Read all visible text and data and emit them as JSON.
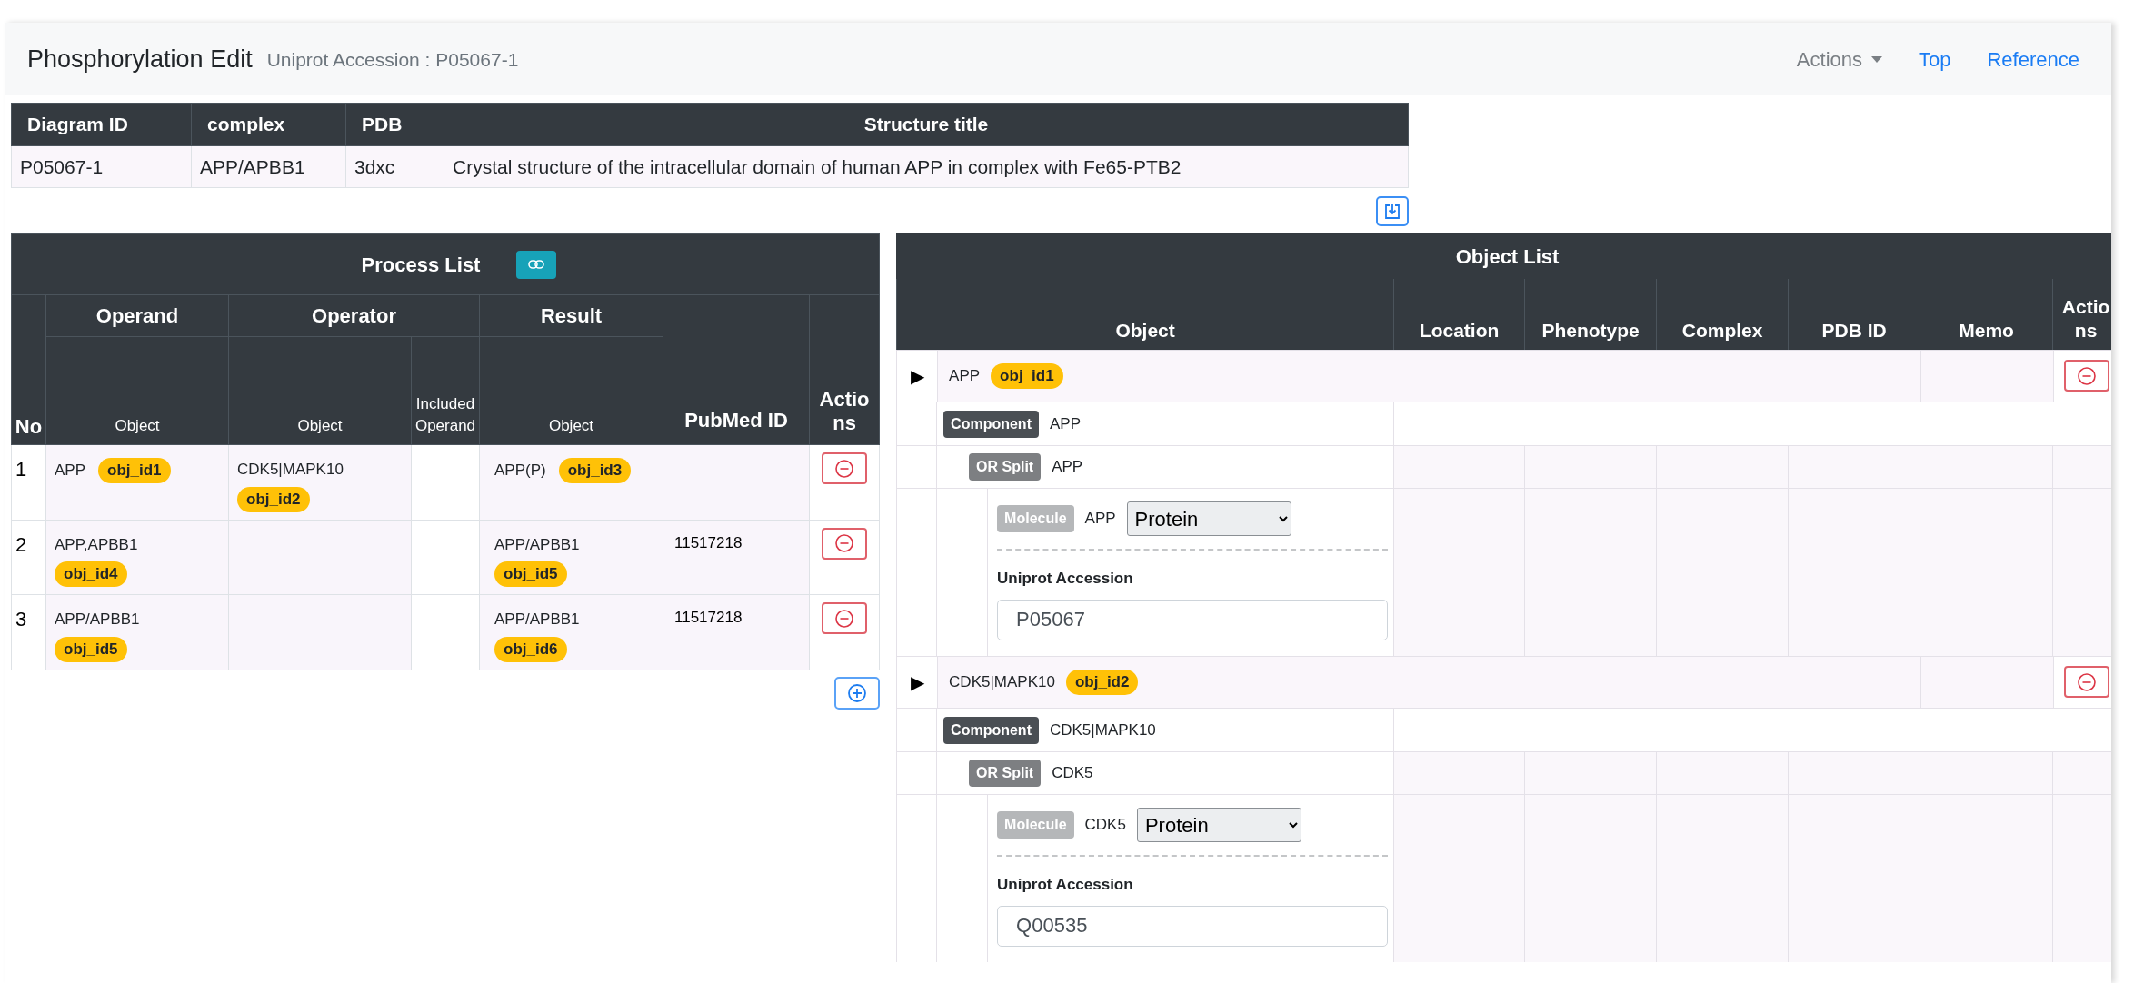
{
  "header": {
    "title": "Phosphorylation Edit",
    "subtitle": "Uniprot Accession : P05067-1",
    "nav": [
      {
        "label": "Actions",
        "kind": "dropdown"
      },
      {
        "label": "Top",
        "kind": "link"
      },
      {
        "label": "Reference",
        "kind": "link"
      }
    ]
  },
  "structure_table": {
    "columns": [
      "Diagram ID",
      "complex",
      "PDB",
      "Structure title"
    ],
    "rows": [
      [
        "P05067-1",
        "APP/APBB1",
        "3dxc",
        "Crystal structure of the intracellular domain of human APP in complex with Fe65-PTB2"
      ]
    ]
  },
  "process_list": {
    "title": "Process List",
    "group_headers": [
      "No",
      "Operand",
      "Operator",
      "Result",
      "PubMed ID",
      "Actions"
    ],
    "sub_headers": [
      "Object",
      "Object",
      "Included Operand",
      "Object"
    ],
    "rows": [
      {
        "no": "1",
        "operand": {
          "name": "APP",
          "id": "obj_id1"
        },
        "operator": {
          "name": "CDK5|MAPK10",
          "id": "obj_id2"
        },
        "result": {
          "name": "APP(P)",
          "id": "obj_id3"
        }
      },
      {
        "no": "2",
        "operand": {
          "name": "APP,APBB1",
          "id": "obj_id4"
        },
        "result": {
          "name": "APP/APBB1",
          "id": "obj_id5"
        },
        "pubmed": "11517218"
      },
      {
        "no": "3",
        "operand": {
          "name": "APP/APBB1",
          "id": "obj_id5"
        },
        "result": {
          "name": "APP/APBB1",
          "id": "obj_id6"
        },
        "pubmed": "11517218"
      }
    ]
  },
  "object_list": {
    "title": "Object List",
    "columns": [
      "Object",
      "Location",
      "Phenotype",
      "Complex",
      "PDB ID",
      "Memo",
      "Actions"
    ],
    "items": [
      {
        "toggle": "▶",
        "name": "APP",
        "id": "obj_id1",
        "children": [
          {
            "kind": "component",
            "badge": "Component",
            "name": "APP",
            "children": [
              {
                "kind": "or_split",
                "badge": "OR Split",
                "name": "APP",
                "children": [
                  {
                    "kind": "molecule",
                    "badge": "Molecule",
                    "name": "APP",
                    "molecule_type": "Protein",
                    "field_label": "Uniprot Accession",
                    "accession": "P05067"
                  }
                ]
              }
            ]
          }
        ]
      },
      {
        "toggle": "▶",
        "name": "CDK5|MAPK10",
        "id": "obj_id2",
        "children": [
          {
            "kind": "component",
            "badge": "Component",
            "name": "CDK5|MAPK10",
            "children": [
              {
                "kind": "or_split",
                "badge": "OR Split",
                "name": "CDK5",
                "children": [
                  {
                    "kind": "molecule",
                    "badge": "Molecule",
                    "name": "CDK5",
                    "molecule_type": "Protein",
                    "field_label": "Uniprot Accession",
                    "accession": "Q00535"
                  }
                ]
              }
            ]
          }
        ]
      }
    ]
  }
}
